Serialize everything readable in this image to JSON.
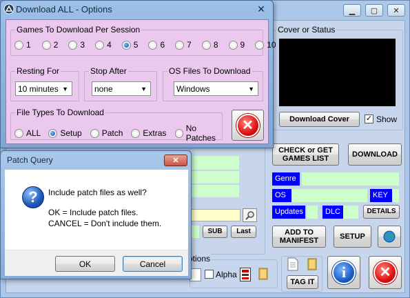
{
  "options_window": {
    "title": "Download ALL - Options",
    "games_per_session": {
      "legend": "Games To Download Per Session",
      "options": [
        "1",
        "2",
        "3",
        "4",
        "5",
        "6",
        "7",
        "8",
        "9",
        "10"
      ],
      "selected": "5"
    },
    "resting_for": {
      "legend": "Resting For",
      "value": "10 minutes"
    },
    "stop_after": {
      "legend": "Stop After",
      "value": "none"
    },
    "os_files": {
      "legend": "OS Files To Download",
      "value": "Windows"
    },
    "file_types": {
      "legend": "File Types To Download",
      "options": [
        "ALL",
        "Setup",
        "Patch",
        "Extras",
        "No Patches"
      ],
      "selected": "Setup"
    }
  },
  "main_window": {
    "cover_legend": "Cover or Status",
    "download_cover": "Download Cover",
    "show_label": "Show",
    "check_games_list": "CHECK or GET GAMES LIST",
    "download": "DOWNLOAD",
    "fields": {
      "genre": "Genre",
      "os": "OS",
      "key": "KEY",
      "updates": "Updates",
      "dlc": "DLC",
      "details": "DETAILS"
    },
    "add_to_manifest": "ADD TO MANIFEST",
    "setup": "SETUP",
    "sub": "SUB",
    "last": "Last",
    "options_legend_partial": "ptions",
    "alpha": "Alpha",
    "tag_it": "TAG IT",
    "info_glyph": "i"
  },
  "patch_dialog": {
    "title": "Patch Query",
    "question": "Include patch files as well?",
    "line1": "OK = Include patch files.",
    "line2": "CANCEL = Don't include them.",
    "ok": "OK",
    "cancel": "Cancel"
  },
  "colors": {
    "pink_panel": "#ebc9ef",
    "blue_label": "#0000ff",
    "light_green": "#ccffcc"
  }
}
